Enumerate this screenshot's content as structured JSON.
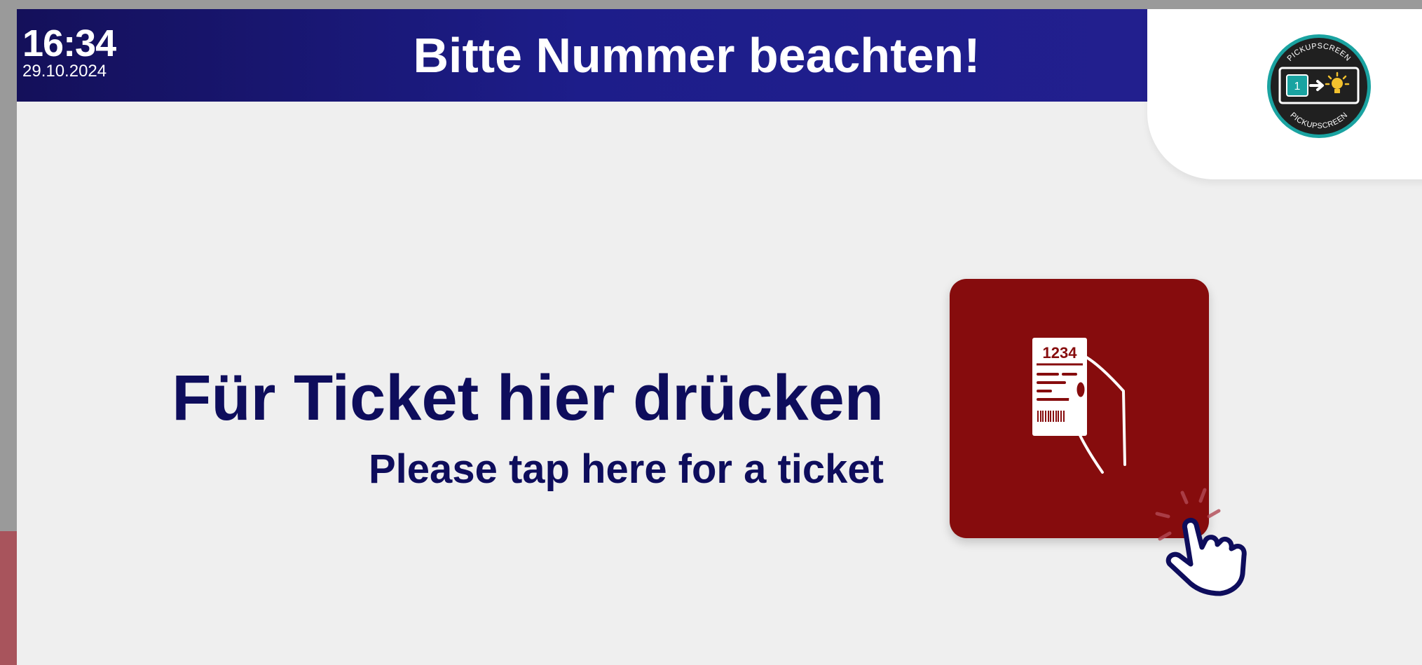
{
  "header": {
    "time": "16:34",
    "date": "29.10.2024",
    "title": "Bitte Nummer beachten!"
  },
  "logo": {
    "text_top": "PICKUPSCREEN",
    "text_bottom": "PICKUPSCREEN",
    "badge_number": "1",
    "icon": "pickupscreen-logo-icon"
  },
  "main": {
    "prompt_de": "Für Ticket hier drücken",
    "prompt_en": "Please tap here for a ticket"
  },
  "ticket_button": {
    "ticket_number": "1234",
    "icon": "ticket-hand-icon",
    "color": "#860c0d"
  },
  "pointer": {
    "icon": "tap-hand-icon"
  },
  "colors": {
    "header_bg": "#1d1d8a",
    "text_primary": "#0e0d5c",
    "background": "#efefef"
  }
}
